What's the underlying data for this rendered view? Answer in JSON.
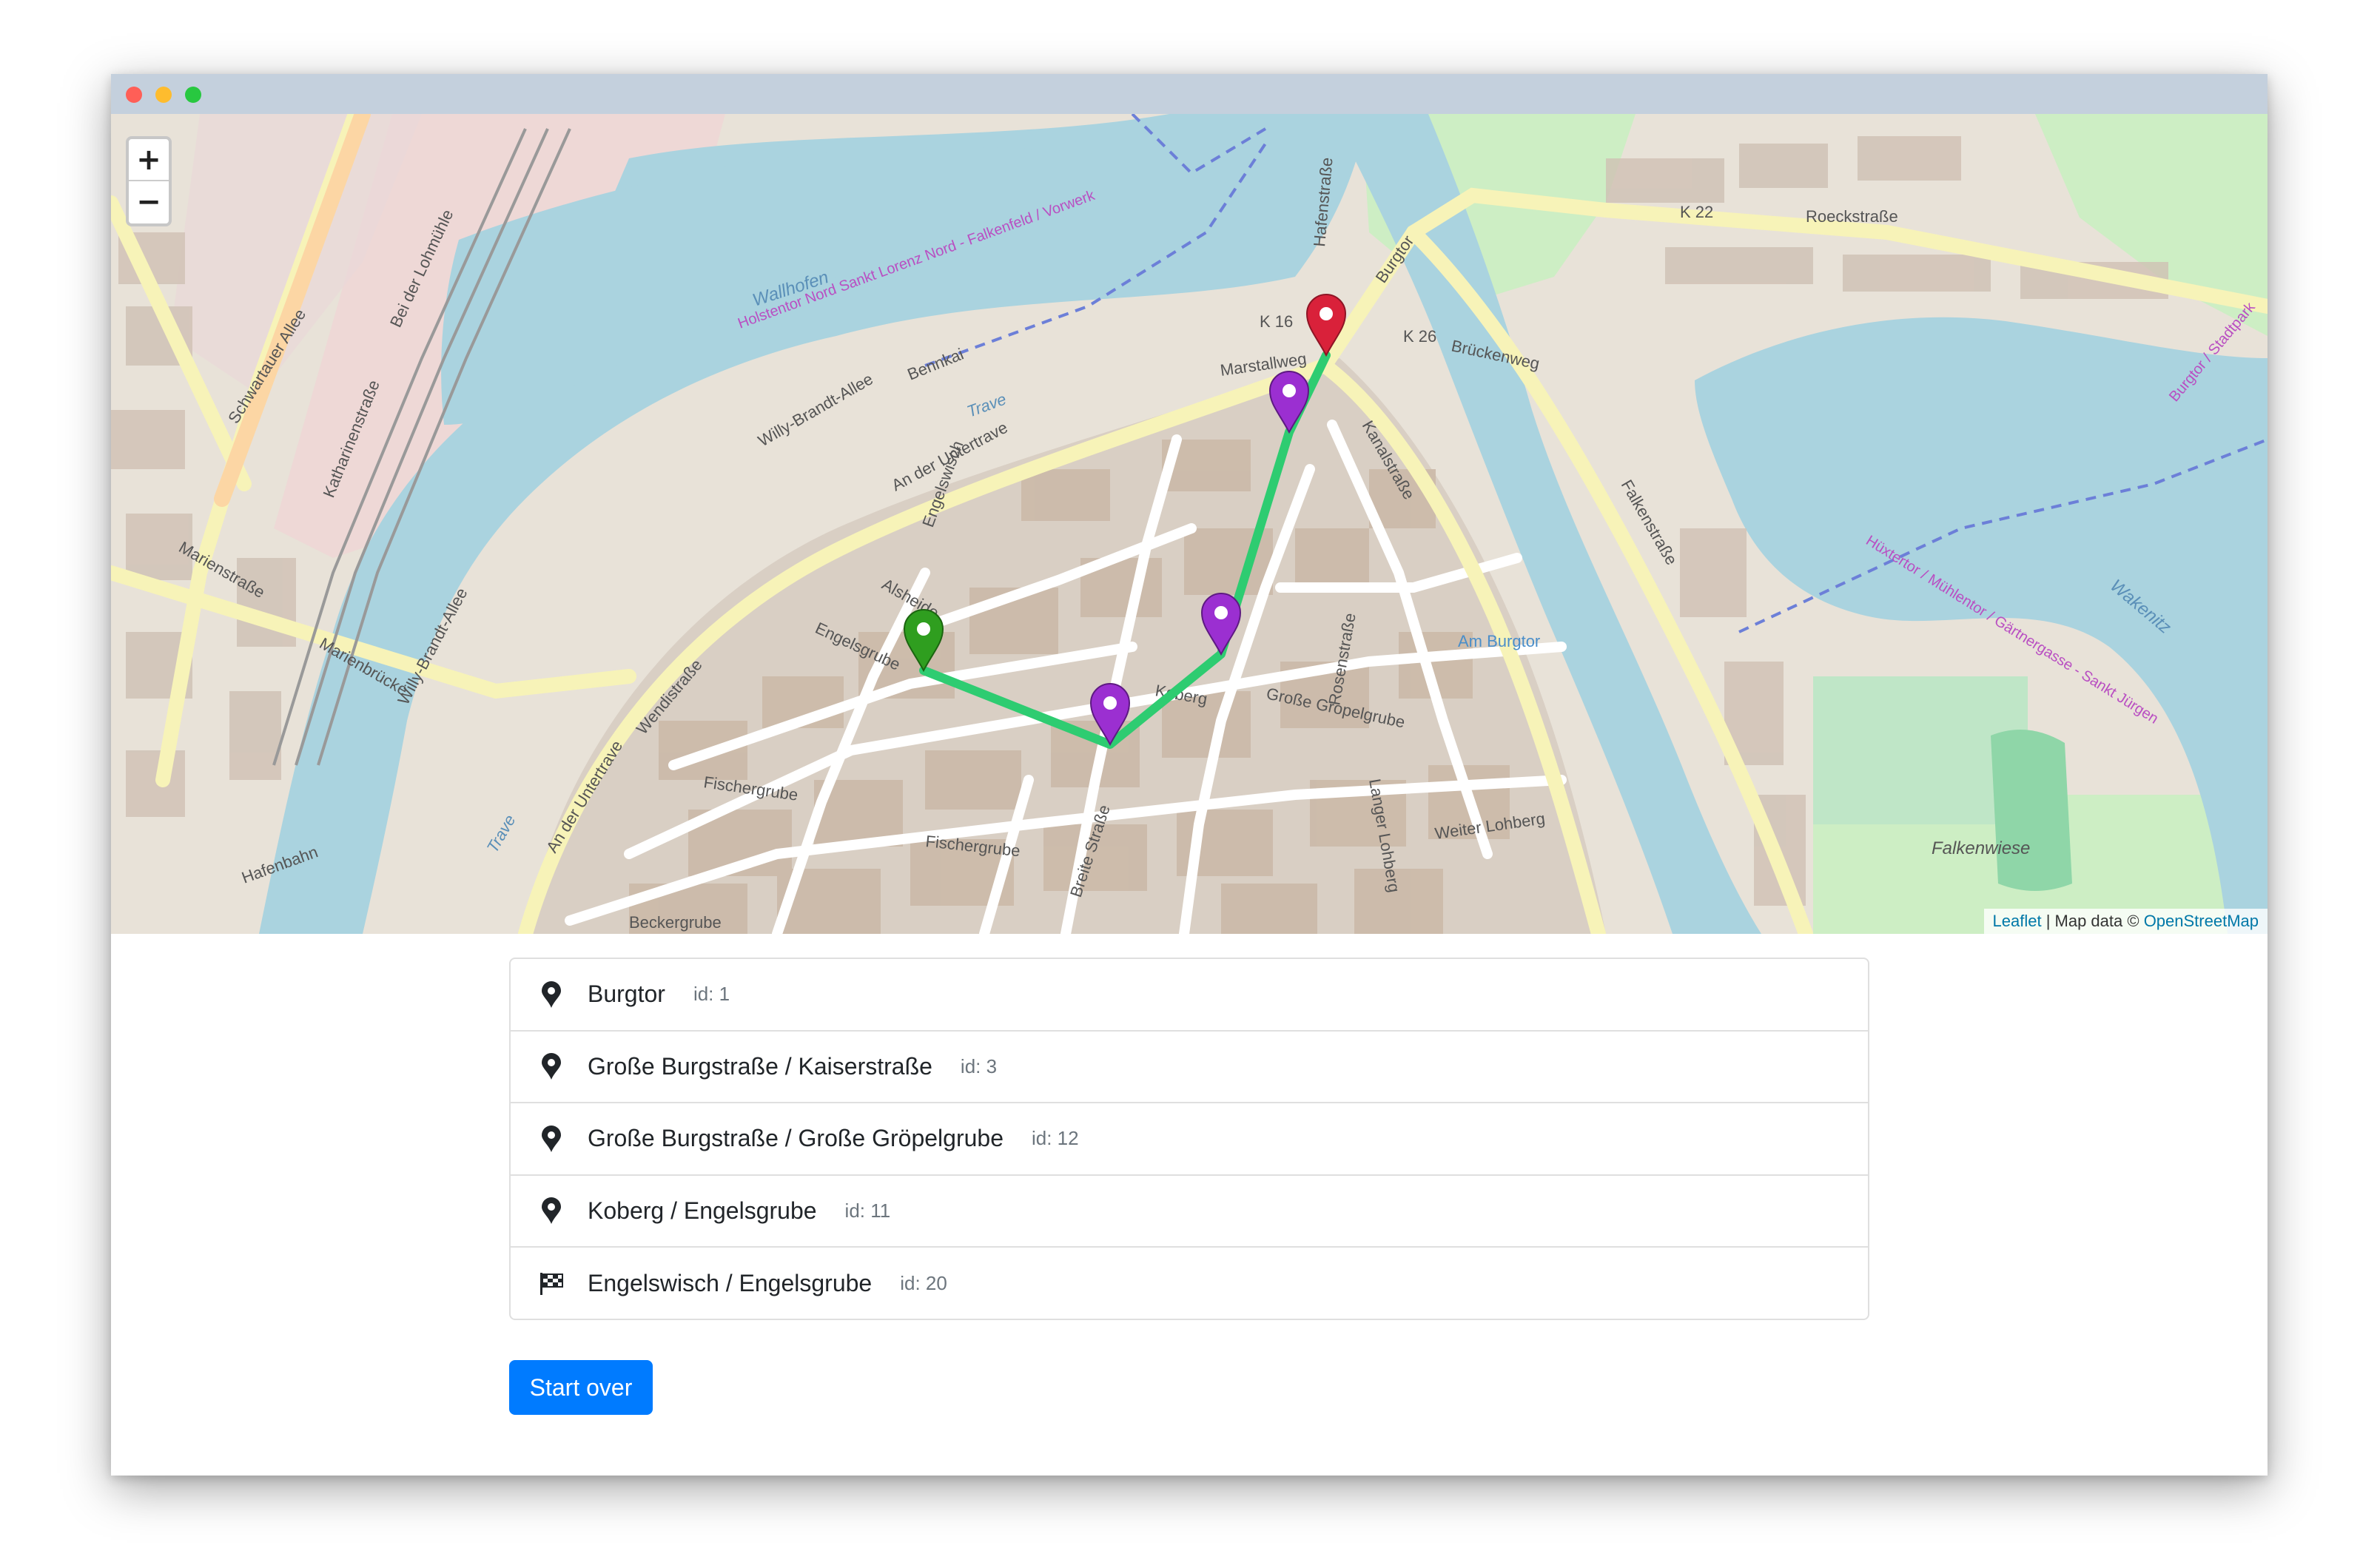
{
  "map": {
    "zoom_in": "+",
    "zoom_out": "−",
    "attribution_leaflet": "Leaflet",
    "attribution_sep": " | Map data © ",
    "attribution_osm": "OpenStreetMap",
    "labels": {
      "k22": "K 22",
      "k16": "K 16",
      "k26": "K 26",
      "roeckstrasse": "Roeckstraße",
      "brueckenweg": "Brückenweg",
      "burgtor": "Burgtor",
      "kanalstrasse": "Kanalstraße",
      "marstallweg": "Marstallweg",
      "an_der_untertrave": "An der Untertrave",
      "an_der_untertrave_2": "An der Untertrave",
      "engelsgrube": "Engelsgrube",
      "grosse_groepelgrube": "Große Gropelgrube",
      "koberg": "Koberg",
      "fischergrube": "Fischergrube",
      "fischergrube_2": "Fischergrube",
      "beckergrube": "Beckergrube",
      "breite_strasse": "Breite Straße",
      "rosenstrasse": "Rosenstraße",
      "langer_lohberg": "Langer Lohberg",
      "weiter_lohberg": "Weiter Lohberg",
      "falkenwiese": "Falkenwiese",
      "am_burgtor": "Am Burgtor",
      "wakenitz": "Wakenitz",
      "trave": "Trave",
      "trave_2": "Trave",
      "wallhofen": "Wallhofen",
      "willy_brandt_allee": "Willy-Brandt-Allee",
      "willy_brandt_allee_2": "Willy-Brandt-Allee",
      "schwartauer_allee": "Schwartauer Allee",
      "marienstrasse": "Marienstraße",
      "marienbruecke": "Marienbrücke",
      "katharinenstrasse": "Katharinenstraße",
      "hafenstrasse": "Hafenstraße",
      "falkenstrasse": "Falkenstraße",
      "engelswisch": "Engelswisch",
      "alsheide": "Alsheide",
      "wendistrasse": "Wendistraße",
      "bei_der_lohmuehle": "Bei der Lohmühle",
      "hafenbahn": "Hafenbahn",
      "bennkai": "Bennkai",
      "holstentor_nord": "Holstentor Nord Sankt Lorenz Nord - Falkenfeld / Vorwerk",
      "burgtor_stadtpark": "Burgtor / Stadtpark",
      "huextertor": "Hüxtertor / Mühlentor / Gärtnergasse - Sankt Jürgen"
    }
  },
  "route": {
    "stops": [
      {
        "name": "Burgtor",
        "id_label": "id: 1",
        "icon": "map-marker-icon"
      },
      {
        "name": "Große Burgstraße / Kaiserstraße",
        "id_label": "id: 3",
        "icon": "map-marker-icon"
      },
      {
        "name": "Große Burgstraße / Große Gröpelgrube",
        "id_label": "id: 12",
        "icon": "map-marker-icon"
      },
      {
        "name": "Koberg / Engelsgrube",
        "id_label": "id: 11",
        "icon": "map-marker-icon"
      },
      {
        "name": "Engelswisch / Engelsgrube",
        "id_label": "id: 20",
        "icon": "checkered-flag-icon"
      }
    ],
    "start_over_label": "Start over",
    "colors": {
      "start_marker": "#d9213a",
      "via_marker": "#9b2fd1",
      "end_marker": "#2f9e1f",
      "route_line": "#2ecc71",
      "water": "#aad3df",
      "button": "#007bff"
    }
  }
}
